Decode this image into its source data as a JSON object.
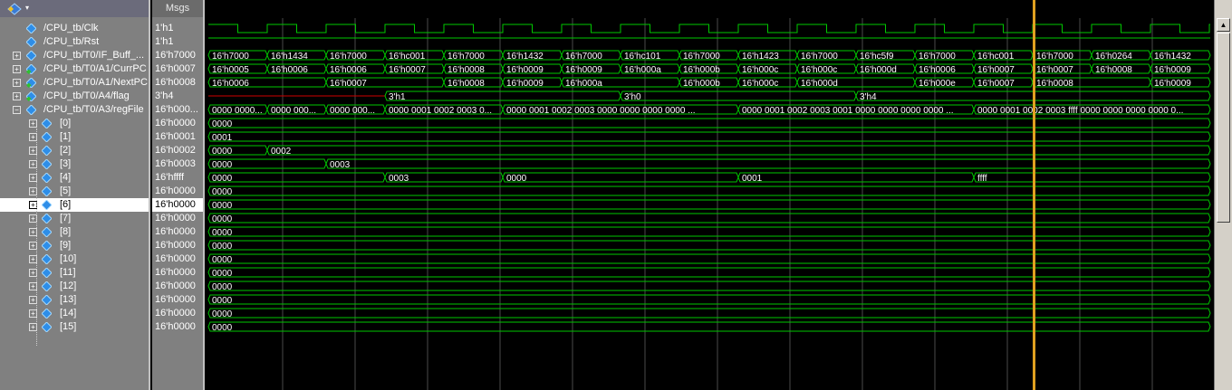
{
  "header": {
    "msgs_label": "Msgs"
  },
  "toolbar": {
    "icon": "wave-signal-icon",
    "dropdown_glyph": "▾"
  },
  "signals": [
    {
      "name": "/CPU_tb/Clk",
      "value": "1'h1",
      "icon": "diamond-blue",
      "expand": ""
    },
    {
      "name": "/CPU_tb/Rst",
      "value": "1'h1",
      "icon": "diamond-blue",
      "expand": ""
    },
    {
      "name": "/CPU_tb/T0/IF_Buff_...",
      "value": "16'h7000",
      "icon": "diamond-blue",
      "expand": "+"
    },
    {
      "name": "/CPU_tb/T0/A1/CurrPC",
      "value": "16'h0007",
      "icon": "diamond-green",
      "expand": "+"
    },
    {
      "name": "/CPU_tb/T0/A1/NextPC",
      "value": "16'h0008",
      "icon": "diamond-green",
      "expand": "+"
    },
    {
      "name": "/CPU_tb/T0/A4/flag",
      "value": "3'h4",
      "icon": "diamond-green",
      "expand": "+"
    },
    {
      "name": "/CPU_tb/T0/A3/regFile",
      "value": "16'h000...",
      "icon": "diamond-blue",
      "expand": "-"
    },
    {
      "name": "[0]",
      "value": "16'h0000",
      "icon": "diamond-blue",
      "expand": "+"
    },
    {
      "name": "[1]",
      "value": "16'h0001",
      "icon": "diamond-blue",
      "expand": "+"
    },
    {
      "name": "[2]",
      "value": "16'h0002",
      "icon": "diamond-blue",
      "expand": "+"
    },
    {
      "name": "[3]",
      "value": "16'h0003",
      "icon": "diamond-blue",
      "expand": "+"
    },
    {
      "name": "[4]",
      "value": "16'hffff",
      "icon": "diamond-blue",
      "expand": "+"
    },
    {
      "name": "[5]",
      "value": "16'h0000",
      "icon": "diamond-blue",
      "expand": "+"
    },
    {
      "name": "[6]",
      "value": "16'h0000",
      "icon": "diamond-blue",
      "expand": "+",
      "selected": true
    },
    {
      "name": "[7]",
      "value": "16'h0000",
      "icon": "diamond-blue",
      "expand": "+"
    },
    {
      "name": "[8]",
      "value": "16'h0000",
      "icon": "diamond-blue",
      "expand": "+"
    },
    {
      "name": "[9]",
      "value": "16'h0000",
      "icon": "diamond-blue",
      "expand": "+"
    },
    {
      "name": "[10]",
      "value": "16'h0000",
      "icon": "diamond-blue",
      "expand": "+"
    },
    {
      "name": "[11]",
      "value": "16'h0000",
      "icon": "diamond-blue",
      "expand": "+"
    },
    {
      "name": "[12]",
      "value": "16'h0000",
      "icon": "diamond-blue",
      "expand": "+"
    },
    {
      "name": "[13]",
      "value": "16'h0000",
      "icon": "diamond-blue",
      "expand": "+"
    },
    {
      "name": "[14]",
      "value": "16'h0000",
      "icon": "diamond-blue",
      "expand": "+"
    },
    {
      "name": "[15]",
      "value": "16'h0000",
      "icon": "diamond-blue",
      "expand": "+"
    }
  ],
  "waves": {
    "clk_period": 65,
    "clk_start": 230,
    "rst": "high",
    "bus": [
      {
        "row": 2,
        "segments": [
          {
            "t": 230,
            "v": "16'h7000"
          },
          {
            "t": 295,
            "v": "16'h1434"
          },
          {
            "t": 360,
            "v": "16'h7000"
          },
          {
            "t": 425,
            "v": "16'hc001"
          },
          {
            "t": 490,
            "v": "16'h7000"
          },
          {
            "t": 555,
            "v": "16'h1432"
          },
          {
            "t": 620,
            "v": "16'h7000"
          },
          {
            "t": 685,
            "v": "16'hc101"
          },
          {
            "t": 750,
            "v": "16'h7000"
          },
          {
            "t": 815,
            "v": "16'h1423"
          },
          {
            "t": 880,
            "v": "16'h7000"
          },
          {
            "t": 945,
            "v": "16'hc5f9"
          },
          {
            "t": 1010,
            "v": "16'h7000"
          },
          {
            "t": 1075,
            "v": "16'hc001"
          },
          {
            "t": 1140,
            "v": "16'h7000"
          },
          {
            "t": 1205,
            "v": "16'h0264"
          },
          {
            "t": 1270,
            "v": "16'h1432"
          }
        ]
      },
      {
        "row": 3,
        "segments": [
          {
            "t": 230,
            "v": "16'h0005"
          },
          {
            "t": 295,
            "v": "16'h0006"
          },
          {
            "t": 360,
            "v": "16'h0006"
          },
          {
            "t": 425,
            "v": "16'h0007"
          },
          {
            "t": 490,
            "v": "16'h0008"
          },
          {
            "t": 555,
            "v": "16'h0009"
          },
          {
            "t": 620,
            "v": "16'h0009"
          },
          {
            "t": 685,
            "v": "16'h000a"
          },
          {
            "t": 750,
            "v": "16'h000b"
          },
          {
            "t": 815,
            "v": "16'h000c"
          },
          {
            "t": 880,
            "v": "16'h000c"
          },
          {
            "t": 945,
            "v": "16'h000d"
          },
          {
            "t": 1010,
            "v": "16'h0006"
          },
          {
            "t": 1075,
            "v": "16'h0007"
          },
          {
            "t": 1140,
            "v": "16'h0007"
          },
          {
            "t": 1205,
            "v": "16'h0008"
          },
          {
            "t": 1270,
            "v": "16'h0009"
          }
        ]
      },
      {
        "row": 4,
        "segments": [
          {
            "t": 230,
            "v": "16'h0006"
          },
          {
            "t": 360,
            "v": "16'h0007"
          },
          {
            "t": 490,
            "v": "16'h0008"
          },
          {
            "t": 555,
            "v": "16'h0009"
          },
          {
            "t": 620,
            "v": "16'h000a"
          },
          {
            "t": 750,
            "v": "16'h000b"
          },
          {
            "t": 815,
            "v": "16'h000c"
          },
          {
            "t": 880,
            "v": "16'h000d"
          },
          {
            "t": 1010,
            "v": "16'h000e"
          },
          {
            "t": 1075,
            "v": "16'h0007"
          },
          {
            "t": 1140,
            "v": "16'h0008"
          },
          {
            "t": 1270,
            "v": "16'h0009"
          }
        ]
      },
      {
        "row": 5,
        "segments": [
          {
            "t": 425,
            "v": "3'h1"
          },
          {
            "t": 685,
            "v": "3'h0"
          },
          {
            "t": 945,
            "v": "3'h4"
          }
        ],
        "undefined_until": 425
      },
      {
        "row": 6,
        "segments": [
          {
            "t": 230,
            "v": "0000 0000..."
          },
          {
            "t": 295,
            "v": "0000 000..."
          },
          {
            "t": 360,
            "v": "0000 000..."
          },
          {
            "t": 425,
            "v": "0000 0001 0002 0003 0..."
          },
          {
            "t": 555,
            "v": "0000 0001 0002 0003 0000 0000 0000 0000 ..."
          },
          {
            "t": 815,
            "v": "0000 0001 0002 0003 0001 0000 0000 0000 0000 ..."
          },
          {
            "t": 1075,
            "v": "0000 0001 0002 0003 ffff 0000 0000 0000 0000 0..."
          }
        ]
      },
      {
        "row": 7,
        "segments": [
          {
            "t": 230,
            "v": "0000"
          }
        ]
      },
      {
        "row": 8,
        "segments": [
          {
            "t": 230,
            "v": "0001"
          }
        ]
      },
      {
        "row": 9,
        "segments": [
          {
            "t": 230,
            "v": "0000"
          },
          {
            "t": 295,
            "v": "0002"
          }
        ]
      },
      {
        "row": 10,
        "segments": [
          {
            "t": 230,
            "v": "0000"
          },
          {
            "t": 360,
            "v": "0003"
          }
        ]
      },
      {
        "row": 11,
        "segments": [
          {
            "t": 230,
            "v": "0000"
          },
          {
            "t": 425,
            "v": "0003"
          },
          {
            "t": 555,
            "v": "0000"
          },
          {
            "t": 815,
            "v": "0001"
          },
          {
            "t": 1075,
            "v": "ffff"
          }
        ]
      },
      {
        "row": 12,
        "segments": [
          {
            "t": 230,
            "v": "0000"
          }
        ]
      },
      {
        "row": 13,
        "segments": [
          {
            "t": 230,
            "v": "0000"
          }
        ]
      },
      {
        "row": 14,
        "segments": [
          {
            "t": 230,
            "v": "0000"
          }
        ]
      },
      {
        "row": 15,
        "segments": [
          {
            "t": 230,
            "v": "0000"
          }
        ]
      },
      {
        "row": 16,
        "segments": [
          {
            "t": 230,
            "v": "0000"
          }
        ]
      },
      {
        "row": 17,
        "segments": [
          {
            "t": 230,
            "v": "0000"
          }
        ]
      },
      {
        "row": 18,
        "segments": [
          {
            "t": 230,
            "v": "0000"
          }
        ]
      },
      {
        "row": 19,
        "segments": [
          {
            "t": 230,
            "v": "0000"
          }
        ]
      },
      {
        "row": 20,
        "segments": [
          {
            "t": 230,
            "v": "0000"
          }
        ]
      },
      {
        "row": 21,
        "segments": [
          {
            "t": 230,
            "v": "0000"
          }
        ]
      },
      {
        "row": 22,
        "segments": [
          {
            "t": 230,
            "v": "0000"
          }
        ]
      }
    ],
    "grid_times": [
      312,
      392,
      472,
      552,
      632,
      712,
      792,
      872,
      952,
      1032,
      1112,
      1192,
      1272
    ],
    "cursor_time": 1140
  },
  "colors": {
    "wave": "#00c800",
    "bus": "#00c800",
    "undefined": "#d00000",
    "cursor": "#e0a020",
    "text": "#ffffff",
    "grid": "#4a4a4a"
  }
}
